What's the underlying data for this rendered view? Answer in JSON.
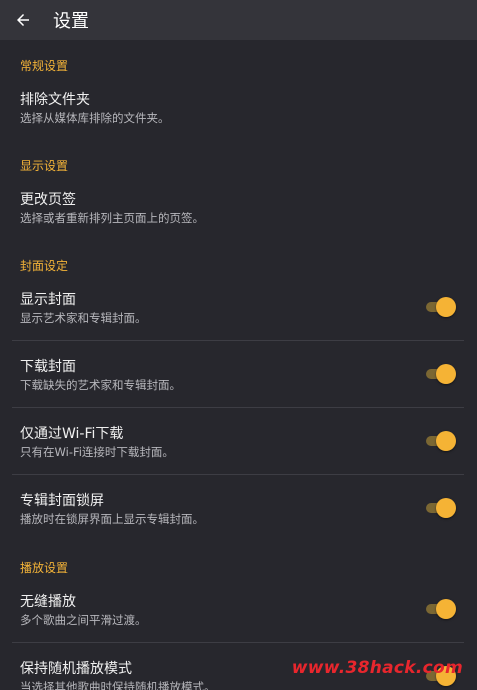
{
  "appbar": {
    "title": "设置",
    "back_icon": "arrow-left-icon"
  },
  "sections": {
    "general": {
      "header": "常规设置",
      "exclude_folders": {
        "title": "排除文件夹",
        "subtitle": "选择从媒体库排除的文件夹。"
      }
    },
    "display": {
      "header": "显示设置",
      "change_tabs": {
        "title": "更改页签",
        "subtitle": "选择或者重新排列主页面上的页签。"
      }
    },
    "cover": {
      "header": "封面设定",
      "show_cover": {
        "title": "显示封面",
        "subtitle": "显示艺术家和专辑封面。",
        "enabled": true
      },
      "download_cover": {
        "title": "下载封面",
        "subtitle": "下载缺失的艺术家和专辑封面。",
        "enabled": true
      },
      "wifi_only": {
        "title": "仅通过Wi-Fi下载",
        "subtitle": "只有在Wi-Fi连接时下载封面。",
        "enabled": true
      },
      "lockscreen_cover": {
        "title": "专辑封面锁屏",
        "subtitle": "播放时在锁屏界面上显示专辑封面。",
        "enabled": true
      }
    },
    "playback": {
      "header": "播放设置",
      "gapless": {
        "title": "无缝播放",
        "subtitle": "多个歌曲之间平滑过渡。",
        "enabled": true
      },
      "keep_shuffle": {
        "title": "保持随机播放模式",
        "subtitle": "当选择其他歌曲时保持随机播放模式。",
        "enabled": true
      }
    }
  },
  "watermark": "www.38hack.com",
  "colors": {
    "background": "#27272d",
    "appbar": "#34343a",
    "accent": "#f5b335",
    "section_header": "#f3b338",
    "switch_track": "#7b6733",
    "watermark": "#e8262d"
  }
}
